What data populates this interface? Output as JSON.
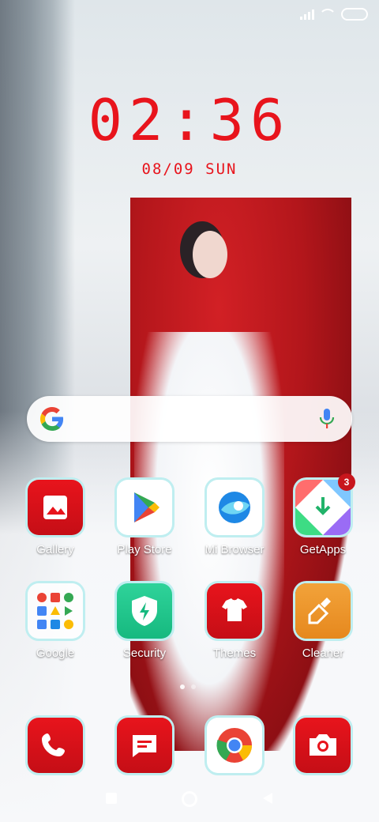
{
  "status": {
    "signal": "signal-icon",
    "wifi": "wifi-icon",
    "battery": "battery-icon"
  },
  "clock": {
    "time": "02:36",
    "date": "08/09 SUN"
  },
  "search": {
    "placeholder": ""
  },
  "apps_row1": [
    {
      "label": "Gallery",
      "icon": "gallery-icon"
    },
    {
      "label": "Play Store",
      "icon": "play-store-icon"
    },
    {
      "label": "Mi Browser",
      "icon": "browser-icon"
    },
    {
      "label": "GetApps",
      "icon": "getapps-icon",
      "badge": "3"
    }
  ],
  "apps_row2": [
    {
      "label": "Google",
      "icon": "google-folder-icon"
    },
    {
      "label": "Security",
      "icon": "security-icon"
    },
    {
      "label": "Themes",
      "icon": "themes-icon"
    },
    {
      "label": "Cleaner",
      "icon": "cleaner-icon"
    }
  ],
  "dock": [
    {
      "icon": "phone-icon"
    },
    {
      "icon": "messages-icon"
    },
    {
      "icon": "chrome-icon"
    },
    {
      "icon": "camera-icon"
    }
  ],
  "nav": {
    "recents": "recents-icon",
    "home": "home-icon",
    "back": "back-icon"
  },
  "colors": {
    "accent": "#e8141c",
    "icon_border": "#bfeef0"
  }
}
